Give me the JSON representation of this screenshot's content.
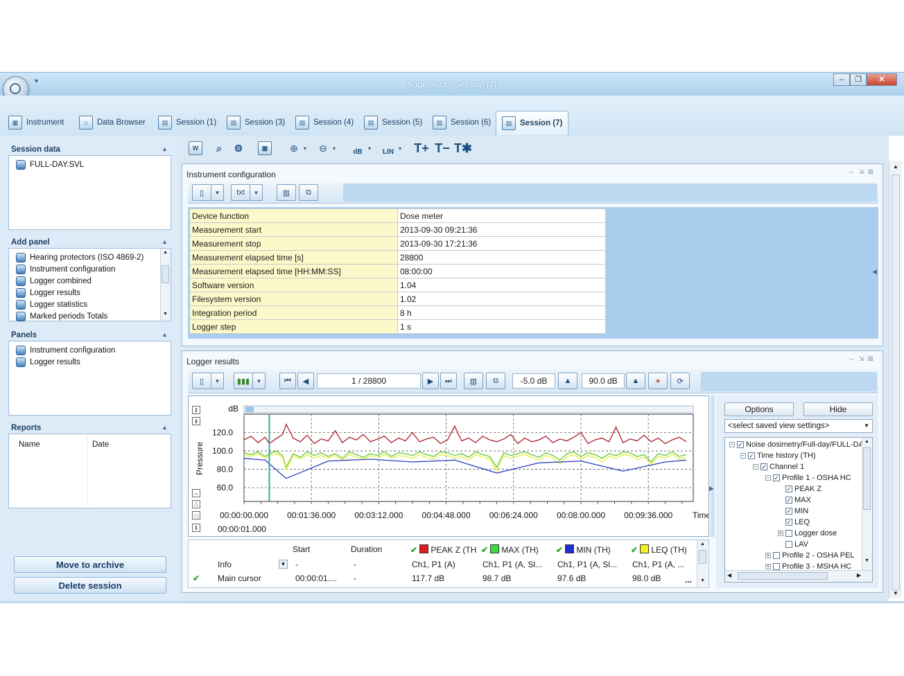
{
  "window": {
    "title": "Supervisor - Session (7)"
  },
  "tabs": [
    {
      "label": "Instrument",
      "icon": "instrument-icon"
    },
    {
      "label": "Data Browser",
      "icon": "data-browser-icon"
    },
    {
      "label": "Session (1)",
      "icon": "session-icon"
    },
    {
      "label": "Session (3)",
      "icon": "session-icon"
    },
    {
      "label": "Session (4)",
      "icon": "session-icon"
    },
    {
      "label": "Session (5)",
      "icon": "session-icon"
    },
    {
      "label": "Session (6)",
      "icon": "session-icon"
    },
    {
      "label": "Session (7)",
      "icon": "session-icon"
    }
  ],
  "left": {
    "session_data": {
      "title": "Session data",
      "file": "FULL-DAY.SVL"
    },
    "add_panel": {
      "title": "Add panel",
      "items": [
        "Hearing protectors (ISO 4869-2)",
        "Instrument configuration",
        "Logger combined",
        "Logger results",
        "Logger statistics",
        "Marked periods Totals"
      ]
    },
    "panels": {
      "title": "Panels",
      "items": [
        "Instrument configuration",
        "Logger results"
      ]
    },
    "reports": {
      "title": "Reports",
      "col_name": "Name",
      "col_date": "Date"
    },
    "buttons": {
      "archive": "Move to archive",
      "delete": "Delete session"
    }
  },
  "toolbar": {
    "t_plus": "T+",
    "t_minus": "T−",
    "t_star": "T✱",
    "db_label": "dB",
    "lin_label": "LIN"
  },
  "config_panel": {
    "title": "Instrument configuration",
    "txt_label": "txt",
    "rows": [
      {
        "k": "Device function",
        "v": "Dose meter"
      },
      {
        "k": "Measurement start",
        "v": "2013-09-30 09:21:36"
      },
      {
        "k": "Measurement stop",
        "v": "2013-09-30 17:21:36"
      },
      {
        "k": "Measurement elapsed time [s]",
        "v": "28800"
      },
      {
        "k": "Measurement elapsed time [HH:MM:SS]",
        "v": "08:00:00"
      },
      {
        "k": "Software version",
        "v": "1.04"
      },
      {
        "k": "Filesystem version",
        "v": "1.02"
      },
      {
        "k": "Integration period",
        "v": "8 h"
      },
      {
        "k": "Logger step",
        "v": "1 s"
      }
    ]
  },
  "logger_panel": {
    "title": "Logger results",
    "position": "1 / 28800",
    "range_min": "-5.0 dB",
    "range_max": "90.0 dB",
    "options": "Options",
    "hide": "Hide",
    "saved_view": "<select saved view settings>",
    "tree": [
      {
        "label": "Noise dosimetry/Full-day/FULL-DA",
        "checked": true,
        "plus": "−"
      },
      {
        "label": "Time history (TH)",
        "checked": true,
        "plus": "−"
      },
      {
        "label": "Channel 1",
        "checked": true,
        "plus": "−"
      },
      {
        "label": "Profile 1 - OSHA HC",
        "checked": true,
        "plus": "−"
      },
      {
        "label": "PEAK Z",
        "checked": true,
        "plus": ""
      },
      {
        "label": "MAX",
        "checked": true,
        "plus": ""
      },
      {
        "label": "MIN",
        "checked": true,
        "plus": ""
      },
      {
        "label": "LEQ",
        "checked": true,
        "plus": ""
      },
      {
        "label": "Logger dose",
        "checked": false,
        "plus": "+"
      },
      {
        "label": "LAV",
        "checked": false,
        "plus": ""
      },
      {
        "label": "Profile 2 - OSHA PEL",
        "checked": false,
        "plus": "+"
      },
      {
        "label": "Profile 3 - MSHA HC",
        "checked": false,
        "plus": "+"
      }
    ],
    "grid": {
      "headers": [
        "",
        "Start",
        "Duration",
        "PEAK Z (TH",
        "MAX (TH)",
        "MIN (TH)",
        "LEQ (TH)"
      ],
      "header_colors": [
        "",
        "",
        "",
        "#e21b1b",
        "#3fd93f",
        "#1c2fd0",
        "#f2f21a"
      ],
      "rows": [
        {
          "name": "Info",
          "start": "-",
          "duration": "-",
          "c1": "Ch1, P1 (A)",
          "c2": "Ch1, P1 (A, Sl...",
          "c3": "Ch1, P1 (A, Sl...",
          "c4": "Ch1, P1 (A, ..."
        },
        {
          "name": "Main cursor",
          "start": "00:00:01....",
          "duration": "-",
          "c1": "117.7 dB",
          "c2": "98.7 dB",
          "c3": "97.6 dB",
          "c4": "98.0 dB"
        }
      ],
      "more": "..."
    }
  },
  "chart_data": {
    "type": "line",
    "title": "",
    "unit": "dB",
    "ylabel": "Pressure",
    "xlabel": "Time",
    "ylim": [
      45,
      140
    ],
    "y_ticks": [
      "120.0",
      "100.0",
      "80.0",
      "60.0"
    ],
    "x_ticks": [
      "00:00:00.000",
      "00:01:36.000",
      "00:03:12.000",
      "00:04:48.000",
      "00:06:24.000",
      "00:08:00.000",
      "00:09:36.000"
    ],
    "cursor_time": "00:00:01.000",
    "grid": true,
    "series": [
      {
        "name": "PEAK Z (TH)",
        "color": "#b01c2a",
        "x": [
          0,
          10,
          20,
          30,
          36,
          45,
          55,
          60,
          70,
          80,
          90,
          100,
          110,
          120,
          130,
          140,
          150,
          160,
          170,
          180,
          190,
          200,
          210,
          220,
          230,
          240,
          250,
          260,
          270,
          280,
          290,
          300,
          310,
          320,
          330,
          340,
          350,
          360,
          370,
          380,
          390,
          400,
          410,
          420,
          430,
          440,
          450,
          460,
          470,
          480,
          490,
          500,
          510,
          520,
          530,
          540,
          550,
          560,
          570,
          580,
          590,
          600,
          610,
          620,
          630
        ],
        "values": [
          112,
          116,
          109,
          115,
          108,
          113,
          118,
          129,
          114,
          110,
          117,
          108,
          113,
          111,
          122,
          109,
          115,
          112,
          118,
          110,
          113,
          116,
          109,
          114,
          111,
          120,
          110,
          113,
          115,
          108,
          112,
          127,
          111,
          114,
          109,
          116,
          112,
          110,
          113,
          118,
          108,
          114,
          110,
          112,
          116,
          109,
          113,
          111,
          115,
          120,
          108,
          112,
          114,
          110,
          126,
          109,
          113,
          111,
          117,
          110,
          114,
          108,
          112,
          115,
          110
        ]
      },
      {
        "name": "MAX (TH)",
        "color": "#63c92a",
        "x": [
          0,
          10,
          20,
          30,
          36,
          45,
          55,
          60,
          70,
          80,
          90,
          100,
          110,
          120,
          130,
          140,
          150,
          160,
          170,
          180,
          190,
          200,
          210,
          220,
          230,
          240,
          250,
          260,
          270,
          280,
          290,
          300,
          310,
          320,
          330,
          340,
          350,
          360,
          370,
          380,
          390,
          400,
          410,
          420,
          430,
          440,
          450,
          460,
          470,
          480,
          490,
          500,
          510,
          520,
          530,
          540,
          550,
          560,
          570,
          580,
          590,
          600,
          610,
          620,
          630
        ],
        "values": [
          98,
          96,
          99,
          94,
          97,
          100,
          95,
          82,
          97,
          93,
          99,
          95,
          98,
          94,
          97,
          92,
          99,
          96,
          93,
          97,
          95,
          99,
          94,
          98,
          97,
          95,
          99,
          96,
          94,
          99,
          98,
          95,
          97,
          93,
          99,
          96,
          94,
          82,
          98,
          95,
          97,
          99,
          96,
          93,
          98,
          95,
          90,
          97,
          99,
          94,
          98,
          96,
          92,
          97,
          95,
          99,
          98,
          94,
          96,
          88,
          97,
          95,
          99,
          94,
          96
        ]
      },
      {
        "name": "MIN (TH)",
        "color": "#2a3fc0",
        "x": [
          0,
          30,
          60,
          120,
          180,
          240,
          300,
          360,
          420,
          480,
          540,
          600,
          630
        ],
        "values": [
          92,
          90,
          70,
          89,
          91,
          88,
          90,
          76,
          87,
          89,
          78,
          88,
          90
        ]
      },
      {
        "name": "LEQ (TH)",
        "color": "#e4ef3a",
        "x": [
          0,
          10,
          20,
          30,
          36,
          45,
          55,
          60,
          70,
          80,
          90,
          100,
          110,
          120,
          130,
          140,
          150,
          160,
          170,
          180,
          190,
          200,
          210,
          220,
          230,
          240,
          250,
          260,
          270,
          280,
          290,
          300,
          310,
          320,
          330,
          340,
          350,
          360,
          370,
          380,
          390,
          400,
          410,
          420,
          430,
          440,
          450,
          460,
          470,
          480,
          490,
          500,
          510,
          520,
          530,
          540,
          550,
          560,
          570,
          580,
          590,
          600,
          610,
          620,
          630
        ],
        "values": [
          96,
          94,
          97,
          92,
          95,
          97,
          93,
          80,
          95,
          91,
          96,
          92,
          95,
          92,
          95,
          90,
          96,
          93,
          91,
          95,
          92,
          96,
          92,
          95,
          94,
          92,
          96,
          93,
          91,
          96,
          95,
          92,
          94,
          90,
          96,
          93,
          91,
          78,
          95,
          92,
          94,
          96,
          93,
          90,
          95,
          92,
          86,
          94,
          96,
          91,
          95,
          93,
          88,
          94,
          92,
          96,
          95,
          91,
          93,
          85,
          94,
          92,
          96,
          91,
          93
        ]
      }
    ]
  }
}
